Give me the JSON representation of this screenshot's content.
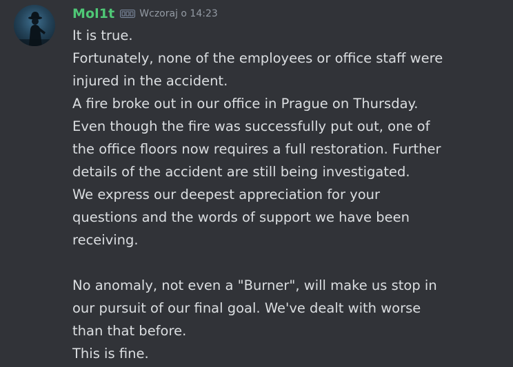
{
  "author": {
    "name": "Mol1t",
    "badge_icon": "server-tag-badge-icon",
    "timestamp": "Wczoraj o 14:23",
    "name_color": "#4fc876"
  },
  "message": {
    "lines": [
      "It is true.",
      "Fortunately, none of the employees or office staff were",
      "injured in the accident.",
      "A fire broke out in our office in Prague on Thursday.",
      "Even though the fire was successfully put out, one of",
      "the office floors now requires a full restoration. Further",
      "details of the accident are still being investigated.",
      "We express our deepest appreciation for your",
      "questions and the words of support we have been",
      "receiving.",
      "",
      "No anomaly, not even a \"Burner\", will make us stop in",
      "our pursuit of our final goal. We've dealt with worse",
      "than that before.",
      "This is fine."
    ]
  },
  "colors": {
    "background": "#313338",
    "text": "#dbdee1",
    "muted": "#949ba4"
  }
}
